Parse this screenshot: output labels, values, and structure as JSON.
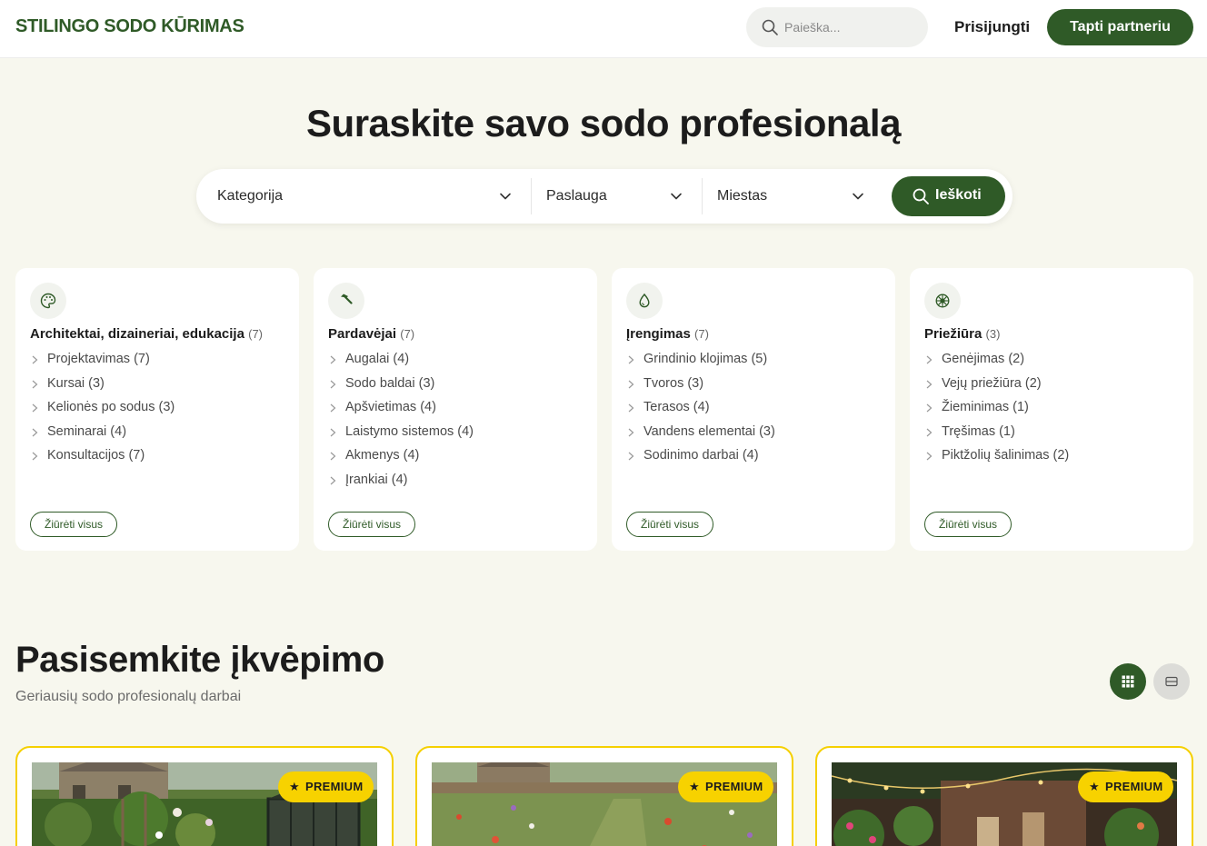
{
  "header": {
    "logo": "STILINGO SODO KŪRIMAS",
    "search_placeholder": "Paieška...",
    "login": "Prisijungti",
    "partner": "Tapti partneriu"
  },
  "hero": {
    "title": "Suraskite savo sodo profesionalą",
    "filters": {
      "category": "Kategorija",
      "service": "Paslauga",
      "city": "Miestas",
      "search_button": "Ieškoti"
    }
  },
  "categories": [
    {
      "icon": "palette-icon",
      "title": "Architektai, dizaineriai, edukacija",
      "count": "(7)",
      "items": [
        "Projektavimas (7)",
        "Kursai (3)",
        "Kelionės po sodus (3)",
        "Seminarai (4)",
        "Konsultacijos (7)"
      ],
      "view_all": "Žiūrėti visus"
    },
    {
      "icon": "hammer-icon",
      "title": "Pardavėjai",
      "count": "(7)",
      "items": [
        "Augalai (4)",
        "Sodo baldai (3)",
        "Apšvietimas (4)",
        "Laistymo sistemos (4)",
        "Akmenys (4)",
        "Įrankiai (4)"
      ],
      "view_all": "Žiūrėti visus"
    },
    {
      "icon": "droplet-icon",
      "title": "Įrengimas",
      "count": "(7)",
      "items": [
        "Grindinio klojimas (5)",
        "Tvoros (3)",
        "Terasos (4)",
        "Vandens elementai (3)",
        "Sodinimo darbai (4)"
      ],
      "view_all": "Žiūrėti visus"
    },
    {
      "icon": "flower-icon",
      "title": "Priežiūra",
      "count": "(3)",
      "items": [
        "Genėjimas (2)",
        "Vejų priežiūra (2)",
        "Žieminimas (1)",
        "Tręšimas (1)",
        "Piktžolių šalinimas (2)"
      ],
      "view_all": "Žiūrėti visus"
    }
  ],
  "inspiration": {
    "title": "Pasisemkite įkvėpimo",
    "subtitle": "Geriausių sodo profesionalų darbai",
    "badge": "PREMIUM"
  },
  "colors": {
    "brand": "#2f5a27",
    "premium": "#f7d200",
    "background": "#f7f7ee"
  }
}
